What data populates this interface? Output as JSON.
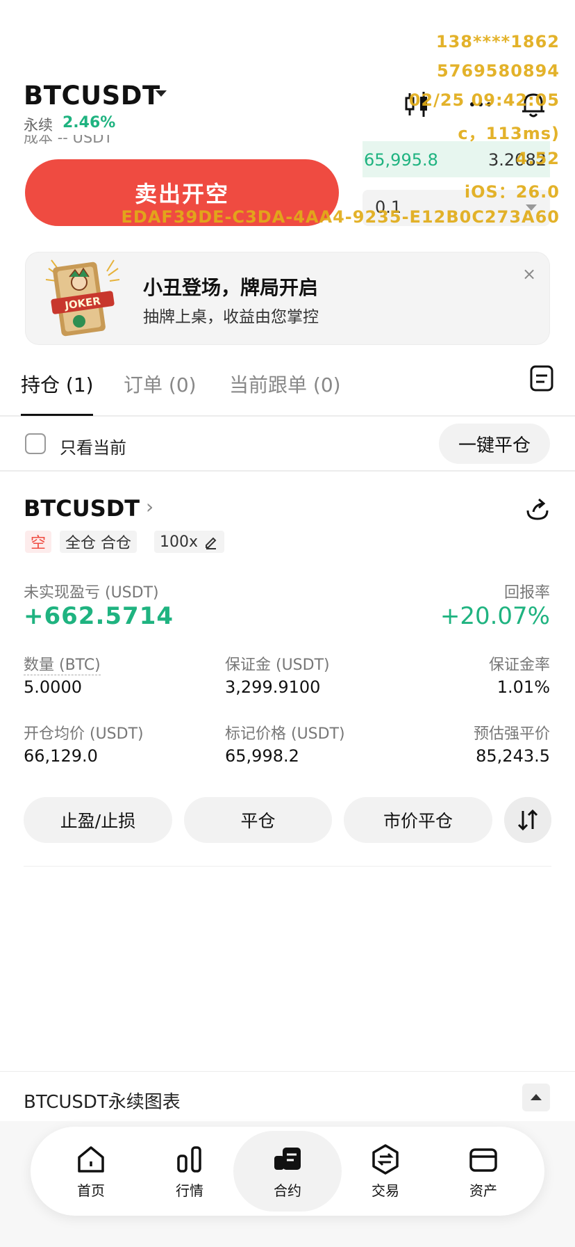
{
  "header": {
    "pair": "BTCUSDT",
    "perpetual_label": "永续",
    "change": "2.46%",
    "cut_left": "成本",
    "cut_right": "-- USDT",
    "sell_button": "卖出开空",
    "book_price": "65,995.8",
    "book_qty": "3.2082",
    "amount_value": "0.1"
  },
  "watermark": {
    "line1": "138****1862",
    "line2": "5769580894",
    "line3": "02/25 09:42:05",
    "line4": "c，113ms)",
    "line5": "4.52",
    "line6": "iOS：26.0",
    "line7": "EDAF39DE-C3DA-4AA4-9235-E12B0C273A60"
  },
  "banner": {
    "title": "小丑登场，牌局开启",
    "subtitle": "抽牌上桌，收益由您掌控",
    "card_text": "JOKER",
    "close": "×"
  },
  "tabs": [
    {
      "label": "持仓 (1)"
    },
    {
      "label": "订单 (0)"
    },
    {
      "label": "当前跟单 (0)"
    }
  ],
  "filter": {
    "only_current": "只看当前",
    "close_all": "一键平仓"
  },
  "position": {
    "symbol": "BTCUSDT",
    "chevron": "›",
    "side_tag": "空",
    "mode_tag": "全仓 合仓",
    "leverage_tag": "100x",
    "pnl_label": "未实现盈亏 (USDT)",
    "pnl_value": "+662.5714",
    "roe_label": "回报率",
    "roe_value": "+20.07%",
    "qty_label": "数量 (BTC)",
    "qty_value": "5.0000",
    "margin_label": "保证金 (USDT)",
    "margin_value": "3,299.9100",
    "margin_ratio_label": "保证金率",
    "margin_ratio_value": "1.01%",
    "entry_label": "开仓均价 (USDT)",
    "entry_value": "66,129.0",
    "mark_label": "标记价格 (USDT)",
    "mark_value": "65,998.2",
    "liq_label": "预估强平价",
    "liq_value": "85,243.5",
    "btn_tpsl": "止盈/止损",
    "btn_close": "平仓",
    "btn_market_close": "市价平仓"
  },
  "chart_bar": {
    "label": "BTCUSDT永续图表"
  },
  "nav": [
    {
      "label": "首页",
      "icon": "home-icon"
    },
    {
      "label": "行情",
      "icon": "market-icon"
    },
    {
      "label": "合约",
      "icon": "futures-icon"
    },
    {
      "label": "交易",
      "icon": "trade-icon"
    },
    {
      "label": "资产",
      "icon": "wallet-icon"
    }
  ],
  "colors": {
    "green": "#1fb380",
    "red": "#ef4b41",
    "watermark": "#e1ac18"
  }
}
